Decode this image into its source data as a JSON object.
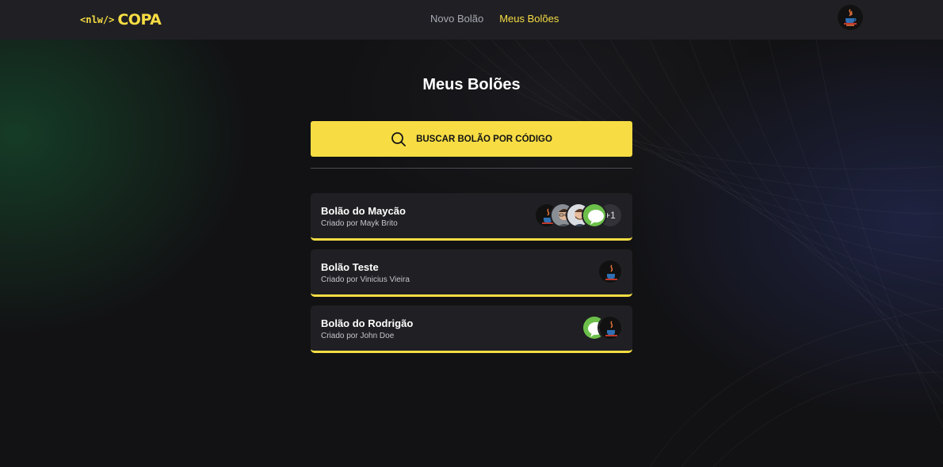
{
  "header": {
    "logo_tag": "<nlw/>",
    "logo_word": "COPA",
    "nav": [
      {
        "label": "Novo Bolão",
        "active": false
      },
      {
        "label": "Meus Bolões",
        "active": true
      }
    ],
    "user_avatar_icon": "java-logo-avatar"
  },
  "page": {
    "title": "Meus Bolões",
    "search_button_label": "BUSCAR BOLÃO POR CÓDIGO",
    "search_icon": "magnifier-icon"
  },
  "pools": [
    {
      "title": "Bolão do Maycão",
      "owner": "Criado por Mayk Brito",
      "participants": [
        "java-logo-avatar",
        "man-glasses-avatar",
        "man-beard-avatar",
        "chat-bubble-avatar"
      ],
      "extra_count": "+1"
    },
    {
      "title": "Bolão Teste",
      "owner": "Criado por Vinicius Vieira",
      "participants": [
        "java-logo-avatar"
      ],
      "extra_count": ""
    },
    {
      "title": "Bolão do Rodrigão",
      "owner": "Criado por John Doe",
      "participants": [
        "chat-bubble-avatar",
        "java-logo-avatar"
      ],
      "extra_count": ""
    }
  ],
  "colors": {
    "accent": "#F7DD43",
    "background": "#121214",
    "surface": "#202024"
  }
}
